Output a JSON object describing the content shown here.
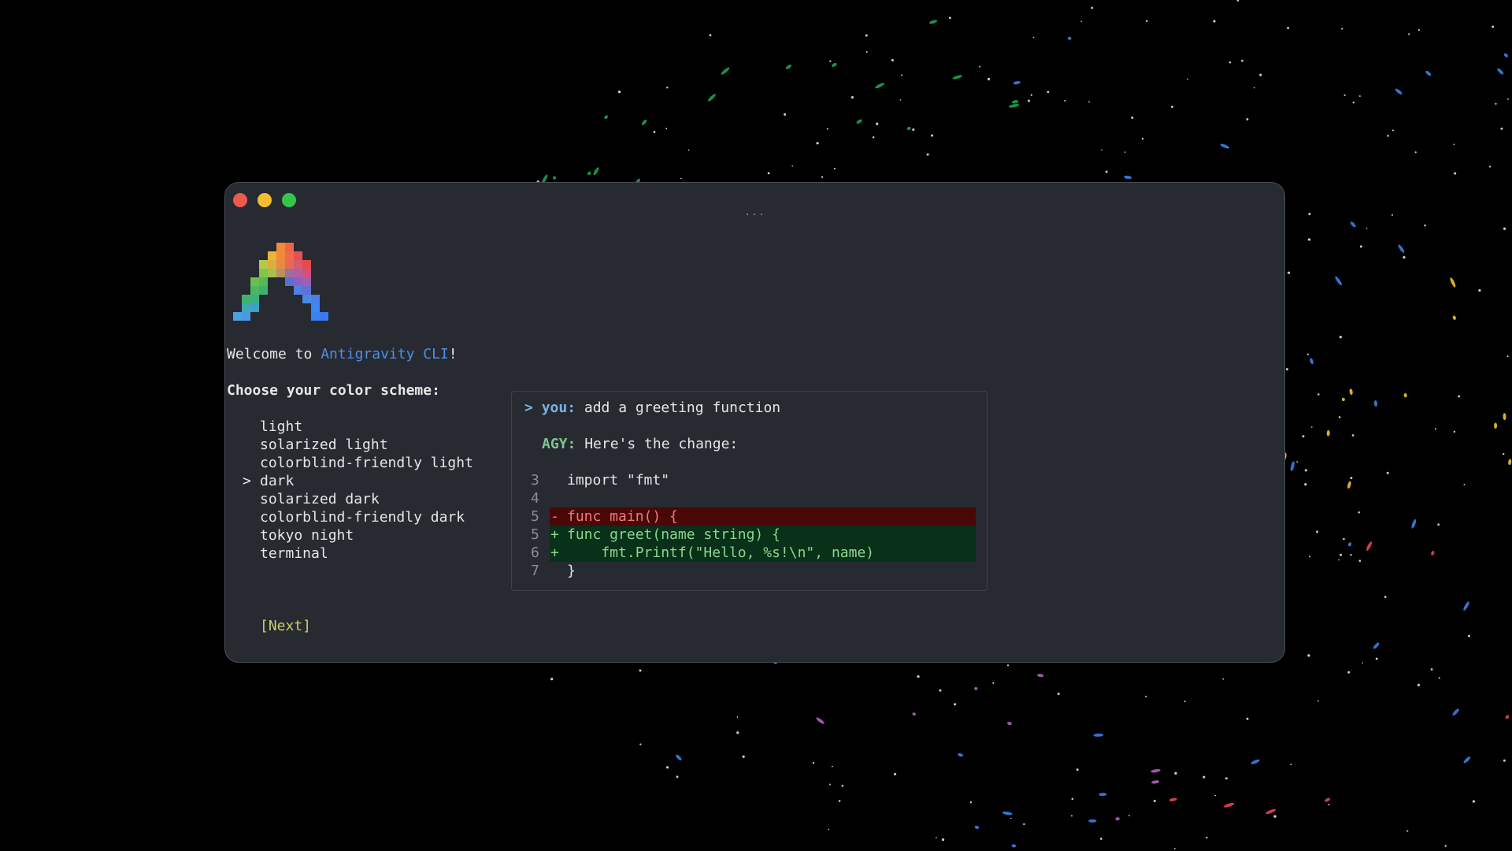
{
  "window": {
    "title_ellipsis": "...",
    "traffic_lights": {
      "close_color": "#ed5a4d",
      "minimize_color": "#f5bd2f",
      "zoom_color": "#35c54a"
    }
  },
  "welcome": {
    "prefix": "Welcome to ",
    "brand": "Antigravity CLI",
    "suffix": "!"
  },
  "prompt": "Choose your color scheme:",
  "schemes": {
    "selected_index": 3,
    "cursor": ">",
    "items": [
      "light",
      "solarized light",
      "colorblind-friendly light",
      "dark",
      "solarized dark",
      "colorblind-friendly dark",
      "tokyo night",
      "terminal"
    ]
  },
  "next_label": "[Next]",
  "preview": {
    "you_prompt": ">",
    "you_label": "you:",
    "you_text": " add a greeting function",
    "agy_label": "AGY:",
    "agy_text": " Here's the change:",
    "code": [
      {
        "num": "3",
        "marker": " ",
        "text": "import \"fmt\"",
        "kind": "context"
      },
      {
        "num": "4",
        "marker": " ",
        "text": "",
        "kind": "context"
      },
      {
        "num": "5",
        "marker": "-",
        "text": "func main() {",
        "kind": "del"
      },
      {
        "num": "5",
        "marker": "+",
        "text": "func greet(name string) {",
        "kind": "add"
      },
      {
        "num": "6",
        "marker": "+",
        "text": "    fmt.Printf(\"Hello, %s!\\n\", name)",
        "kind": "add"
      },
      {
        "num": "7",
        "marker": " ",
        "text": "}",
        "kind": "context"
      }
    ]
  },
  "colors": {
    "background": "#000000",
    "window_bg": "#272a31",
    "brand": "#4d8fe8",
    "next": "#cdcd6a",
    "diff_del_bg": "#4a0707",
    "diff_add_bg": "#093018"
  }
}
